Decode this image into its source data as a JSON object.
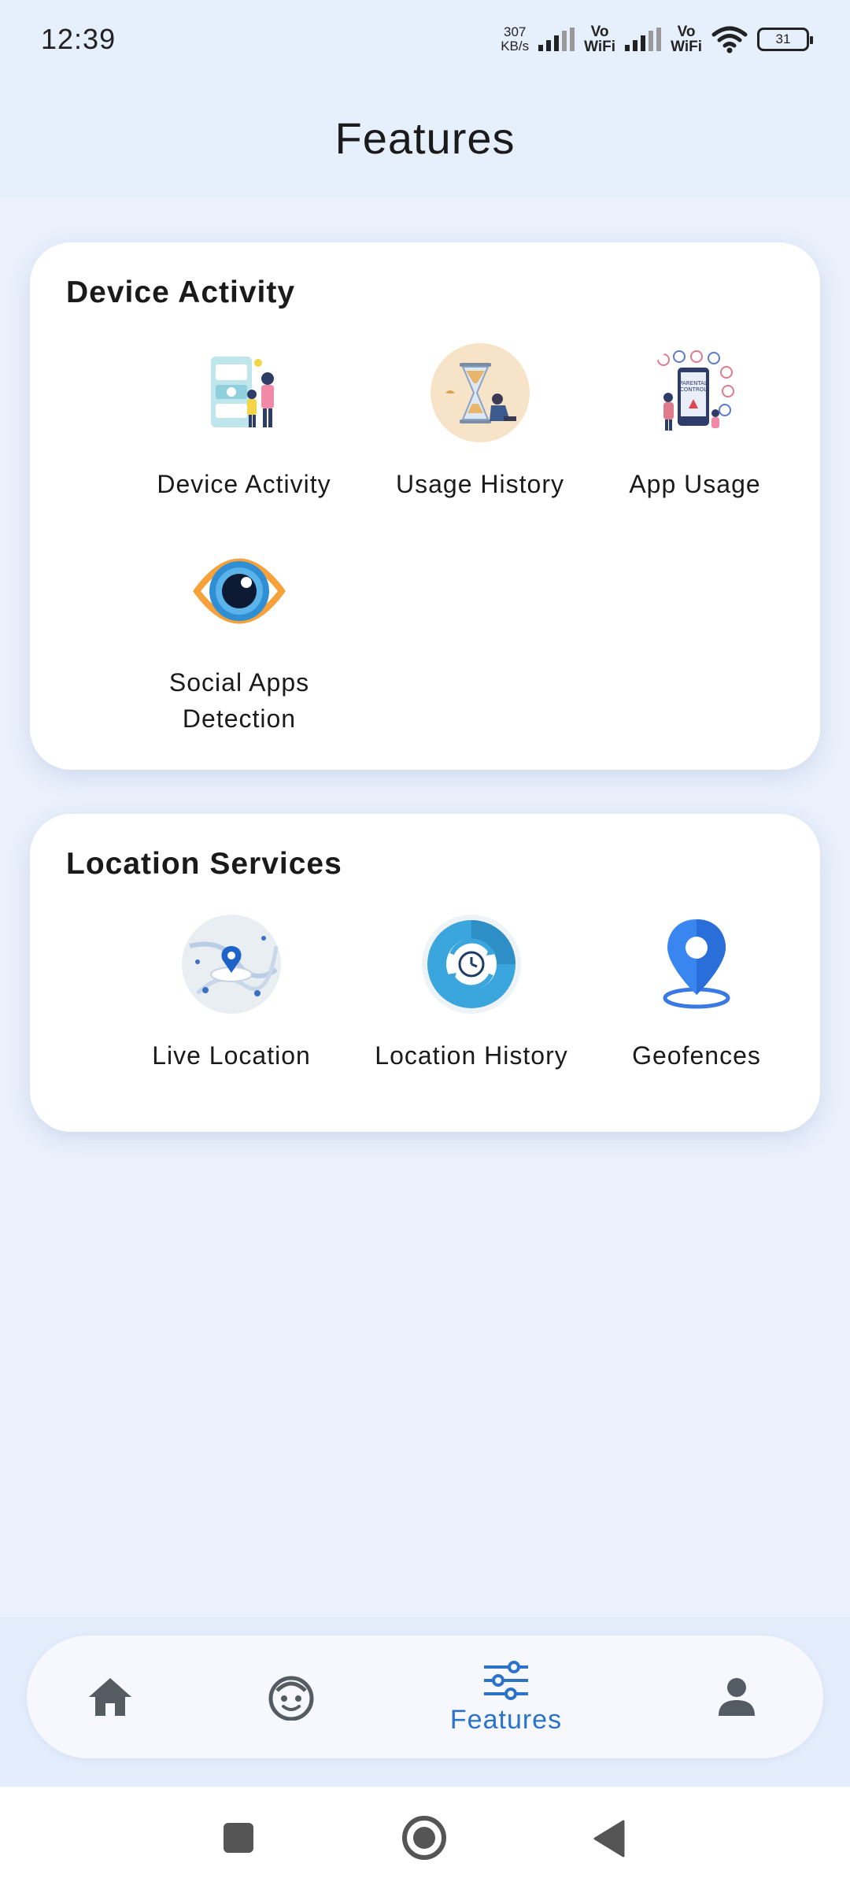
{
  "status_bar": {
    "time": "12:39",
    "net_speed_value": "307",
    "net_speed_unit": "KB/s",
    "volte_1_top": "Vo",
    "volte_1_bottom": "WiFi",
    "volte_2_top": "Vo",
    "volte_2_bottom": "WiFi",
    "battery": "31"
  },
  "header": {
    "title": "Features"
  },
  "sections": [
    {
      "title": "Device Activity",
      "items": [
        {
          "label": "Device Activity",
          "icon": "device-activity-illustration"
        },
        {
          "label": "Usage History",
          "icon": "hourglass-illustration"
        },
        {
          "label": "App Usage",
          "icon": "parental-control-illustration"
        },
        {
          "label_line1": "Social Apps",
          "label_line2": "Detection",
          "icon": "eye-icon"
        }
      ]
    },
    {
      "title": "Location Services",
      "items": [
        {
          "label": "Live Location",
          "icon": "map-pin-illustration"
        },
        {
          "label": "Location History",
          "icon": "clock-history-icon"
        },
        {
          "label": "Geofences",
          "icon": "geofence-pin-icon"
        }
      ]
    }
  ],
  "bottom_nav": {
    "items": [
      {
        "icon": "home-icon"
      },
      {
        "icon": "child-face-icon"
      },
      {
        "icon": "sliders-icon",
        "label": "Features",
        "active": true
      },
      {
        "icon": "person-icon"
      }
    ],
    "active_color": "#2b73c9",
    "inactive_color": "#555b63"
  },
  "system_nav": {
    "buttons": [
      "recents-button",
      "home-button",
      "back-button"
    ]
  }
}
